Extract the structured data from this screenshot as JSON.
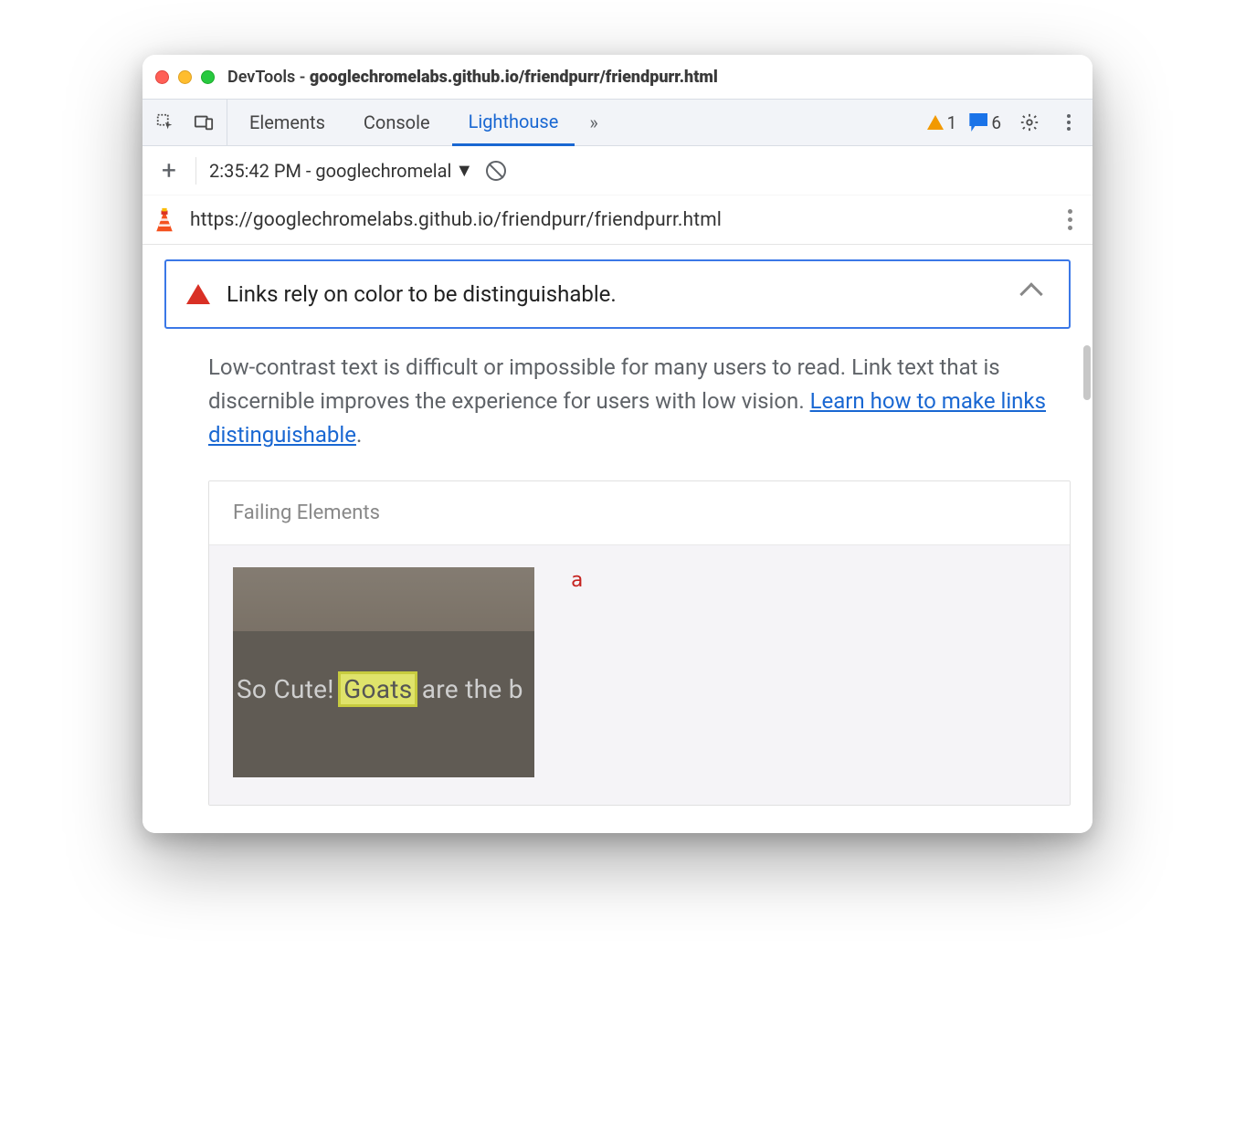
{
  "window": {
    "title_prefix": "DevTools - ",
    "title_host": "googlechromelabs.github.io/friendpurr/friendpurr.html"
  },
  "tabs": {
    "elements": "Elements",
    "console": "Console",
    "lighthouse": "Lighthouse"
  },
  "counts": {
    "warnings": "1",
    "messages": "6"
  },
  "subbar": {
    "report_label": "2:35:42 PM - googlechromelal"
  },
  "url": "https://googlechromelabs.github.io/friendpurr/friendpurr.html",
  "audit": {
    "title": "Links rely on color to be distinguishable.",
    "desc_pre": "Low-contrast text is difficult or impossible for many users to read. Link text that is discernible improves the experience for users with low vision. ",
    "learn_link": "Learn how to make links distinguishable",
    "desc_post": "."
  },
  "failing": {
    "heading": "Failing Elements",
    "thumb_text_pre": "So Cute! ",
    "thumb_highlight": "Goats",
    "thumb_text_post": " are the b",
    "element_tag": "a"
  }
}
